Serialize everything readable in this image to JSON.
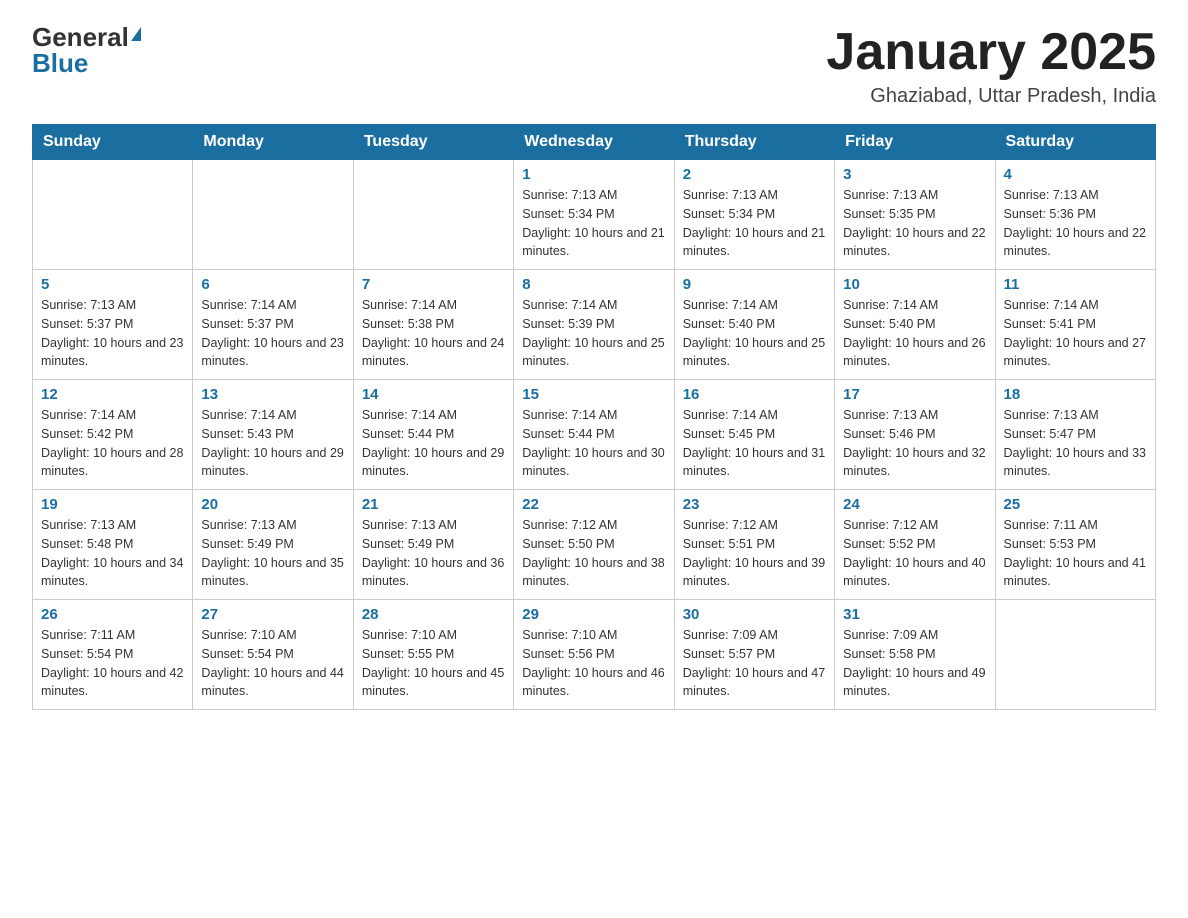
{
  "logo": {
    "general": "General",
    "blue": "Blue"
  },
  "header": {
    "month": "January 2025",
    "location": "Ghaziabad, Uttar Pradesh, India"
  },
  "weekdays": [
    "Sunday",
    "Monday",
    "Tuesday",
    "Wednesday",
    "Thursday",
    "Friday",
    "Saturday"
  ],
  "weeks": [
    [
      {
        "day": "",
        "info": ""
      },
      {
        "day": "",
        "info": ""
      },
      {
        "day": "",
        "info": ""
      },
      {
        "day": "1",
        "info": "Sunrise: 7:13 AM\nSunset: 5:34 PM\nDaylight: 10 hours and 21 minutes."
      },
      {
        "day": "2",
        "info": "Sunrise: 7:13 AM\nSunset: 5:34 PM\nDaylight: 10 hours and 21 minutes."
      },
      {
        "day": "3",
        "info": "Sunrise: 7:13 AM\nSunset: 5:35 PM\nDaylight: 10 hours and 22 minutes."
      },
      {
        "day": "4",
        "info": "Sunrise: 7:13 AM\nSunset: 5:36 PM\nDaylight: 10 hours and 22 minutes."
      }
    ],
    [
      {
        "day": "5",
        "info": "Sunrise: 7:13 AM\nSunset: 5:37 PM\nDaylight: 10 hours and 23 minutes."
      },
      {
        "day": "6",
        "info": "Sunrise: 7:14 AM\nSunset: 5:37 PM\nDaylight: 10 hours and 23 minutes."
      },
      {
        "day": "7",
        "info": "Sunrise: 7:14 AM\nSunset: 5:38 PM\nDaylight: 10 hours and 24 minutes."
      },
      {
        "day": "8",
        "info": "Sunrise: 7:14 AM\nSunset: 5:39 PM\nDaylight: 10 hours and 25 minutes."
      },
      {
        "day": "9",
        "info": "Sunrise: 7:14 AM\nSunset: 5:40 PM\nDaylight: 10 hours and 25 minutes."
      },
      {
        "day": "10",
        "info": "Sunrise: 7:14 AM\nSunset: 5:40 PM\nDaylight: 10 hours and 26 minutes."
      },
      {
        "day": "11",
        "info": "Sunrise: 7:14 AM\nSunset: 5:41 PM\nDaylight: 10 hours and 27 minutes."
      }
    ],
    [
      {
        "day": "12",
        "info": "Sunrise: 7:14 AM\nSunset: 5:42 PM\nDaylight: 10 hours and 28 minutes."
      },
      {
        "day": "13",
        "info": "Sunrise: 7:14 AM\nSunset: 5:43 PM\nDaylight: 10 hours and 29 minutes."
      },
      {
        "day": "14",
        "info": "Sunrise: 7:14 AM\nSunset: 5:44 PM\nDaylight: 10 hours and 29 minutes."
      },
      {
        "day": "15",
        "info": "Sunrise: 7:14 AM\nSunset: 5:44 PM\nDaylight: 10 hours and 30 minutes."
      },
      {
        "day": "16",
        "info": "Sunrise: 7:14 AM\nSunset: 5:45 PM\nDaylight: 10 hours and 31 minutes."
      },
      {
        "day": "17",
        "info": "Sunrise: 7:13 AM\nSunset: 5:46 PM\nDaylight: 10 hours and 32 minutes."
      },
      {
        "day": "18",
        "info": "Sunrise: 7:13 AM\nSunset: 5:47 PM\nDaylight: 10 hours and 33 minutes."
      }
    ],
    [
      {
        "day": "19",
        "info": "Sunrise: 7:13 AM\nSunset: 5:48 PM\nDaylight: 10 hours and 34 minutes."
      },
      {
        "day": "20",
        "info": "Sunrise: 7:13 AM\nSunset: 5:49 PM\nDaylight: 10 hours and 35 minutes."
      },
      {
        "day": "21",
        "info": "Sunrise: 7:13 AM\nSunset: 5:49 PM\nDaylight: 10 hours and 36 minutes."
      },
      {
        "day": "22",
        "info": "Sunrise: 7:12 AM\nSunset: 5:50 PM\nDaylight: 10 hours and 38 minutes."
      },
      {
        "day": "23",
        "info": "Sunrise: 7:12 AM\nSunset: 5:51 PM\nDaylight: 10 hours and 39 minutes."
      },
      {
        "day": "24",
        "info": "Sunrise: 7:12 AM\nSunset: 5:52 PM\nDaylight: 10 hours and 40 minutes."
      },
      {
        "day": "25",
        "info": "Sunrise: 7:11 AM\nSunset: 5:53 PM\nDaylight: 10 hours and 41 minutes."
      }
    ],
    [
      {
        "day": "26",
        "info": "Sunrise: 7:11 AM\nSunset: 5:54 PM\nDaylight: 10 hours and 42 minutes."
      },
      {
        "day": "27",
        "info": "Sunrise: 7:10 AM\nSunset: 5:54 PM\nDaylight: 10 hours and 44 minutes."
      },
      {
        "day": "28",
        "info": "Sunrise: 7:10 AM\nSunset: 5:55 PM\nDaylight: 10 hours and 45 minutes."
      },
      {
        "day": "29",
        "info": "Sunrise: 7:10 AM\nSunset: 5:56 PM\nDaylight: 10 hours and 46 minutes."
      },
      {
        "day": "30",
        "info": "Sunrise: 7:09 AM\nSunset: 5:57 PM\nDaylight: 10 hours and 47 minutes."
      },
      {
        "day": "31",
        "info": "Sunrise: 7:09 AM\nSunset: 5:58 PM\nDaylight: 10 hours and 49 minutes."
      },
      {
        "day": "",
        "info": ""
      }
    ]
  ]
}
